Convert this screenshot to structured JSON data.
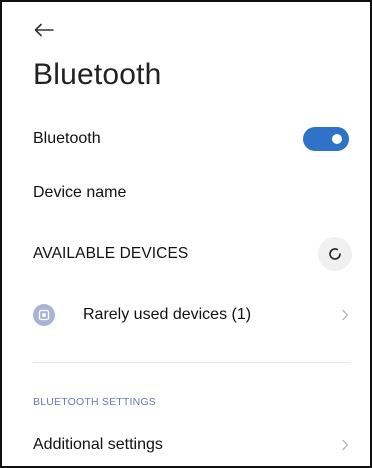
{
  "header": {
    "back_icon": "back-arrow-icon",
    "title": "Bluetooth"
  },
  "bluetooth_toggle": {
    "label": "Bluetooth",
    "state": "on",
    "accent_color": "#2f73c9"
  },
  "device_name": {
    "label": "Device name"
  },
  "available_devices": {
    "label": "AVAILABLE DEVICES",
    "refresh_icon": "refresh-icon"
  },
  "rarely_used": {
    "label": "Rarely used devices (1)",
    "icon": "device-icon",
    "chevron_icon": "chevron-right-icon"
  },
  "bluetooth_settings": {
    "section_label": "BLUETOOTH SETTINGS",
    "additional_label": "Additional settings",
    "chevron_icon": "chevron-right-icon"
  }
}
